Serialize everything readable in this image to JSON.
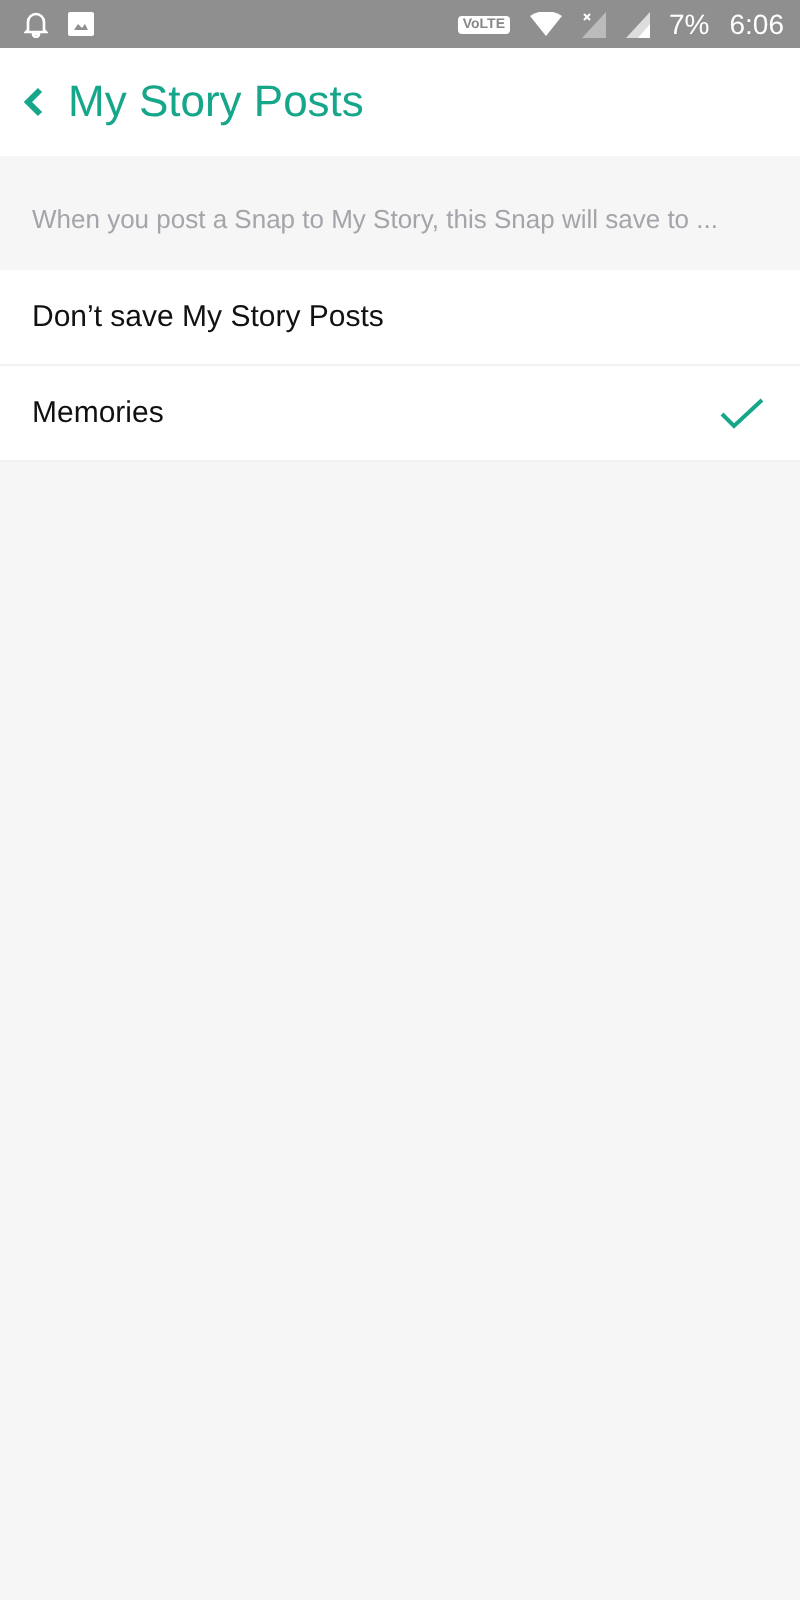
{
  "status_bar": {
    "volte": "VoLTE",
    "battery": "7%",
    "time": "6:06"
  },
  "header": {
    "title": "My Story Posts"
  },
  "description": "When you post a Snap to My Story, this Snap will save to ...",
  "options": [
    {
      "label": "Don’t save My Story Posts",
      "selected": false
    },
    {
      "label": "Memories",
      "selected": true
    }
  ]
}
